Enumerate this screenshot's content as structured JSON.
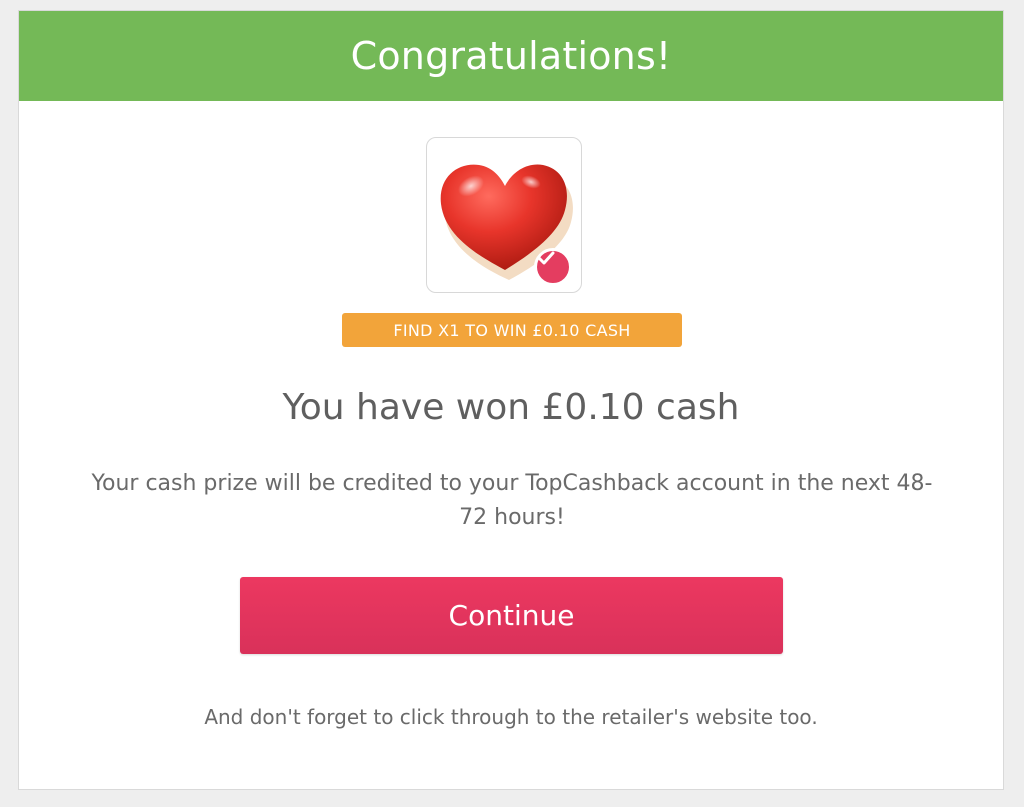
{
  "modal": {
    "header_title": "Congratulations!",
    "prize_icon": "heart-icon",
    "badge_icon": "checkmark-icon",
    "find_tag_text": "FIND X1 TO WIN £0.10 CASH",
    "won_title": "You have won £0.10 cash",
    "description": "Your cash prize will be credited to your TopCashback account in the next 48-72 hours!",
    "continue_label": "Continue",
    "footer_note": "And don't forget to click through to the retailer's website too."
  },
  "colors": {
    "header_bg": "#74b957",
    "tag_bg": "#f2a43a",
    "button_bg": "#e33a5f",
    "badge_bg": "#e43d60",
    "text_gray": "#5f5f5f"
  }
}
